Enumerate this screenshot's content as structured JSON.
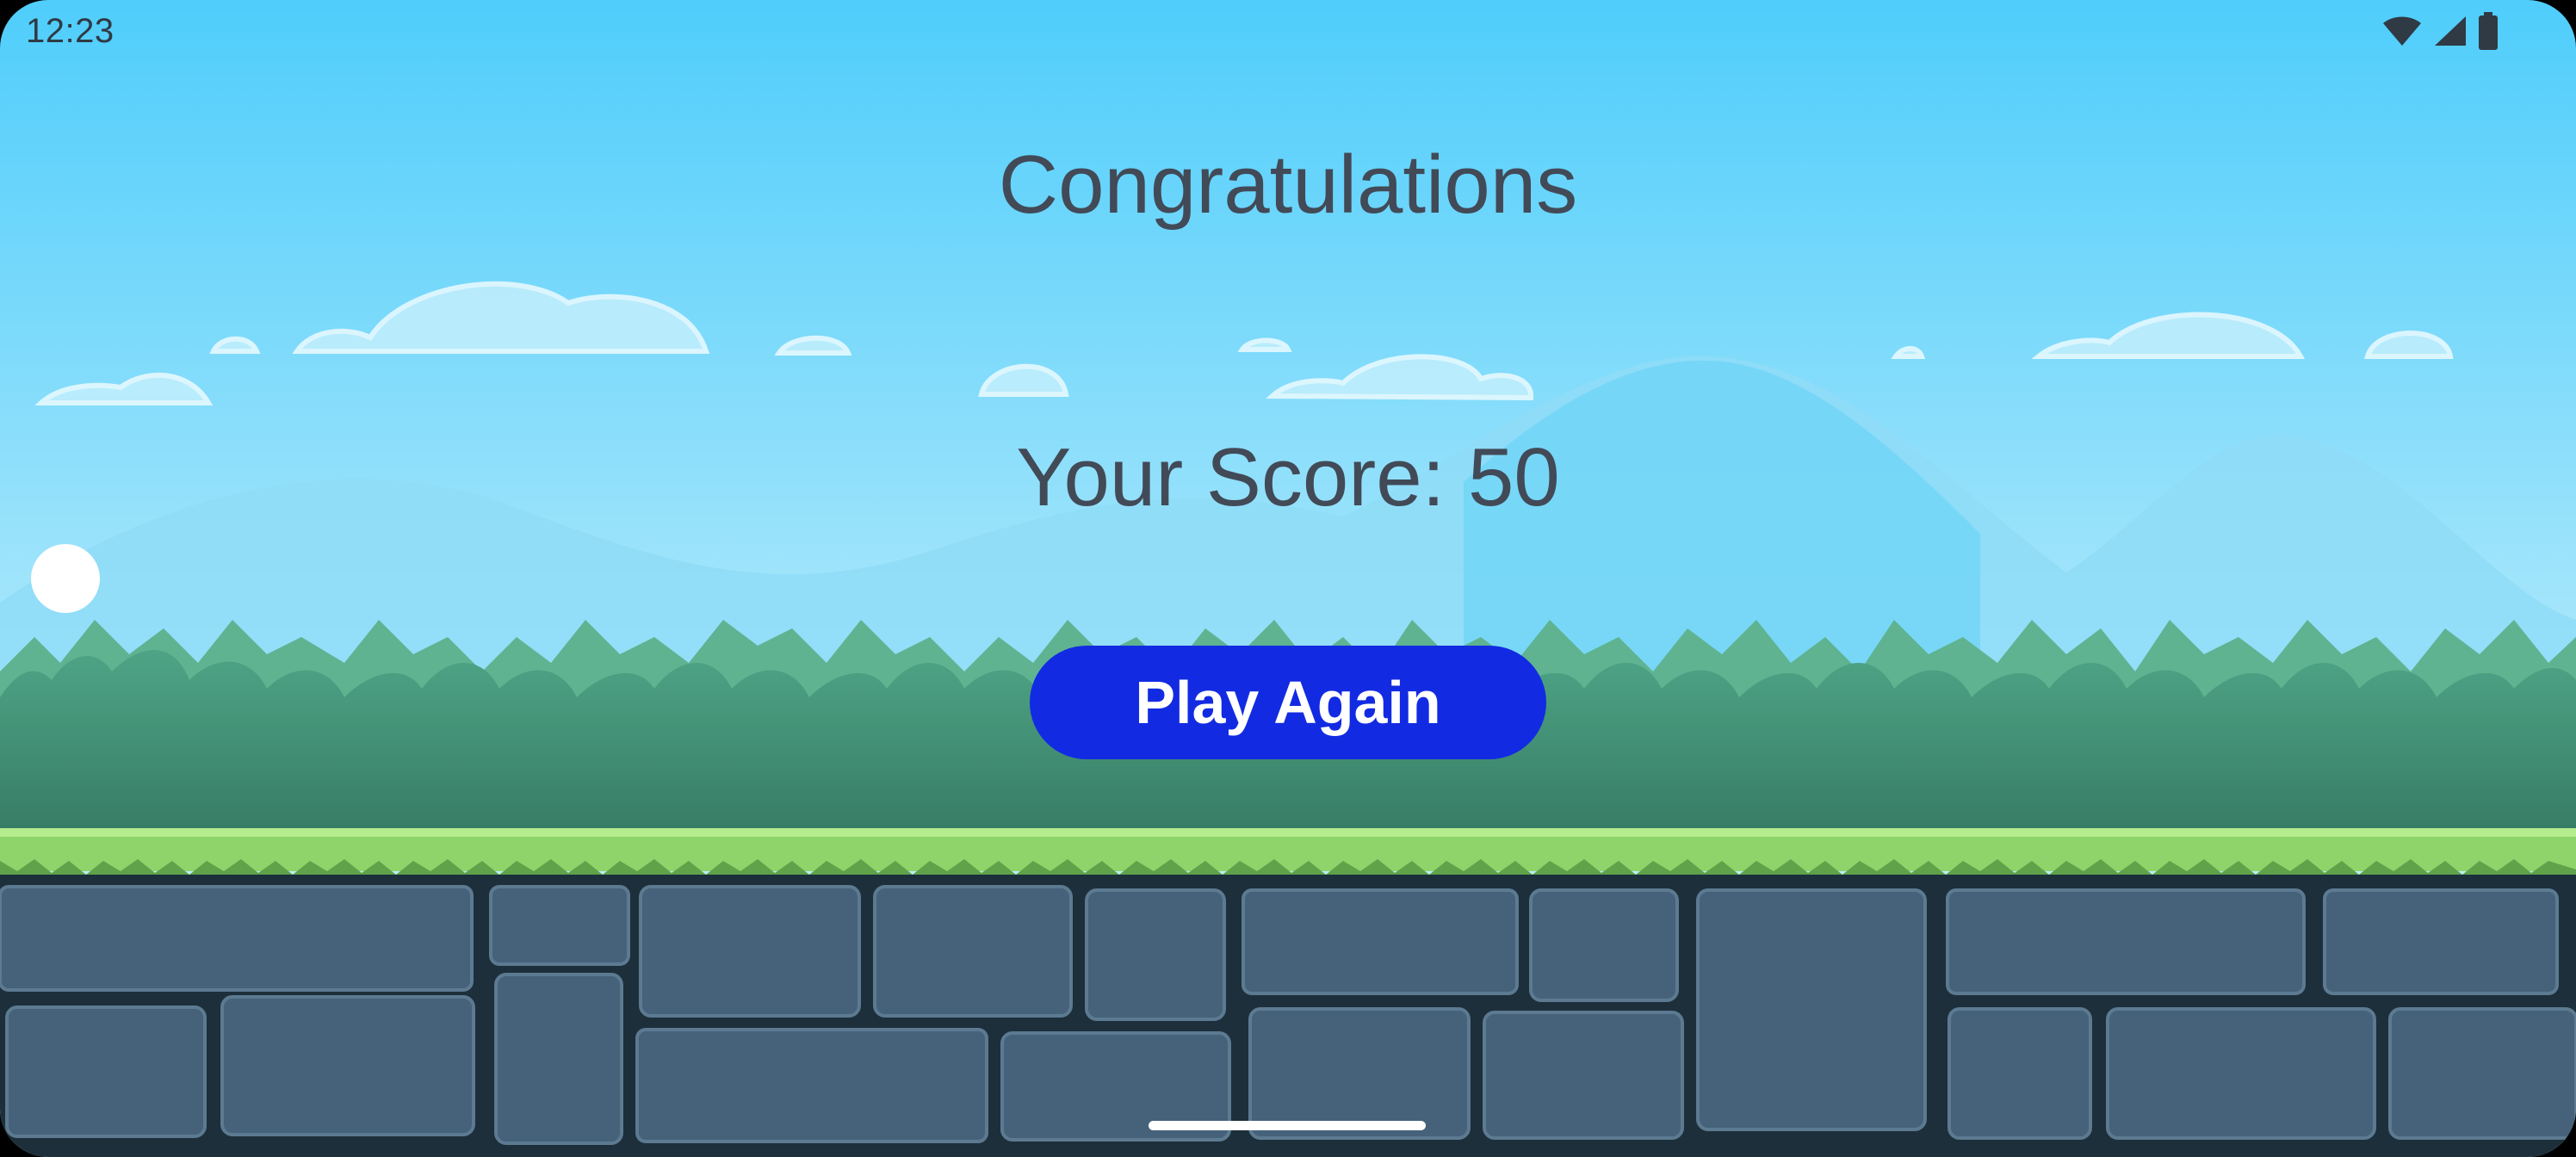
{
  "status_bar": {
    "time": "12:23",
    "icons": [
      "wifi-icon",
      "signal-icon",
      "battery-icon"
    ]
  },
  "game_over": {
    "title": "Congratulations",
    "score_text": "Your Score: 50",
    "play_again_label": "Play Again"
  },
  "colors": {
    "button": "#122be2",
    "text": "#424a57",
    "sky_top": "#4fcdfb",
    "grass": "#8fd46a",
    "stone": "#46627a"
  }
}
